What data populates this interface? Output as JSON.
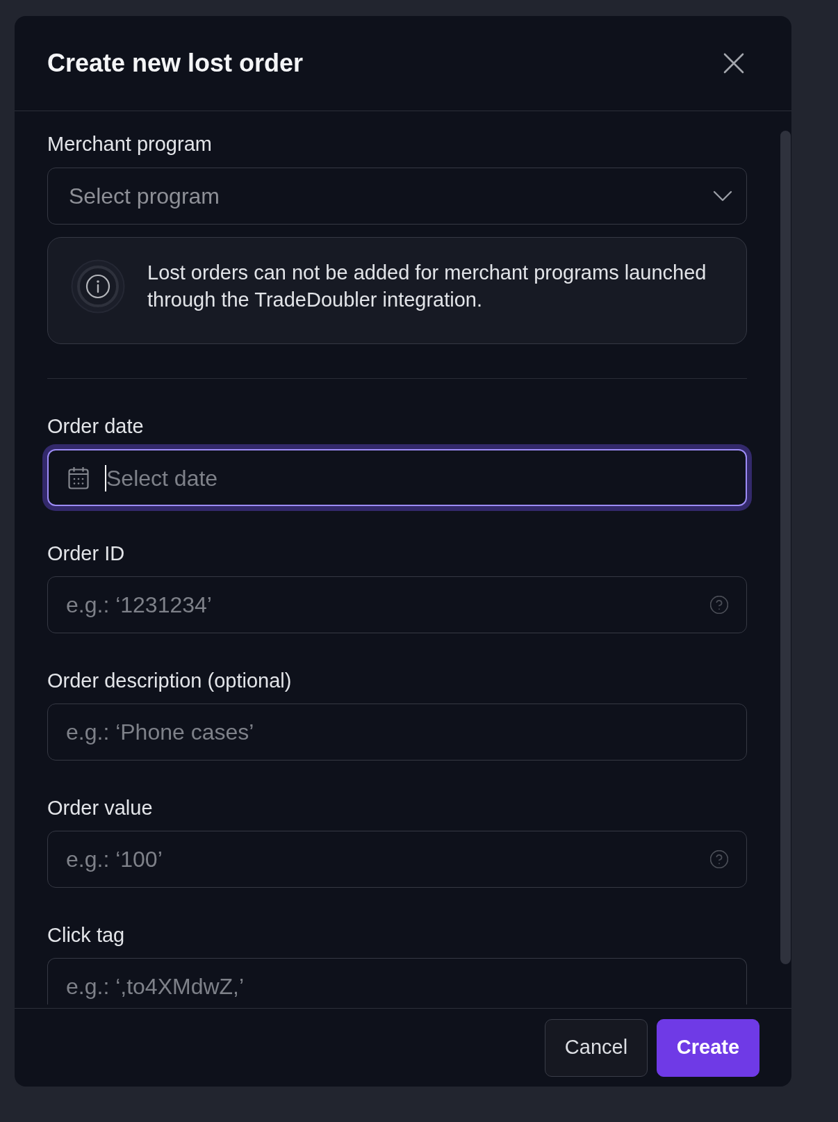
{
  "dialog": {
    "title": "Create new lost order"
  },
  "merchant_program": {
    "label": "Merchant program",
    "placeholder": "Select program"
  },
  "notice": {
    "text": "Lost orders can not be added for merchant programs launched through the TradeDoubler integration."
  },
  "fields": [
    {
      "kind": "date",
      "label": "Order date",
      "placeholder": "Select date",
      "focused": true,
      "help": false
    },
    {
      "kind": "text",
      "label": "Order ID",
      "placeholder": "e.g.: ‘1231234’",
      "focused": false,
      "help": true
    },
    {
      "kind": "text",
      "label": "Order description (optional)",
      "placeholder": "e.g.: ‘Phone cases’",
      "focused": false,
      "help": false
    },
    {
      "kind": "text",
      "label": "Order value",
      "placeholder": "e.g.: ‘100’",
      "focused": false,
      "help": true
    },
    {
      "kind": "text",
      "label": "Click tag",
      "placeholder": "e.g.: ‘,to4XMdwZ,’",
      "focused": false,
      "help": false
    }
  ],
  "buttons": [
    {
      "label": "Cancel",
      "kind": "secondary"
    },
    {
      "label": "Create",
      "kind": "primary"
    }
  ]
}
